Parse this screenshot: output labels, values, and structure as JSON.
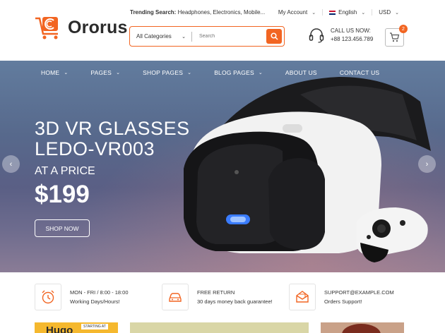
{
  "brand": {
    "name": "Ororus",
    "accent": "#f26522"
  },
  "header": {
    "trending_label": "Trending Search:",
    "trending_terms": "Headphones, Electronics, Mobile...",
    "account": "My Account",
    "language": "English",
    "currency": "USD",
    "search": {
      "category": "All Categories",
      "placeholder": "Search"
    },
    "call": {
      "label": "CALL US NOW:",
      "number": "+88 123.456.789"
    },
    "cart_count": "2"
  },
  "nav": {
    "items": [
      {
        "label": "HOME",
        "dropdown": true
      },
      {
        "label": "PAGES",
        "dropdown": true
      },
      {
        "label": "SHOP PAGES",
        "dropdown": true
      },
      {
        "label": "BLOG PAGES",
        "dropdown": true
      },
      {
        "label": "ABOUT US",
        "dropdown": false
      },
      {
        "label": "CONTACT US",
        "dropdown": false
      }
    ]
  },
  "hero": {
    "title_line1": "3D VR GLASSES",
    "title_line2": "LEDO-VR003",
    "price_label": "AT A PRICE",
    "price": "$199",
    "cta": "SHOP NOW"
  },
  "features": [
    {
      "icon": "alarm-clock-icon",
      "title": "MON - FRI / 8:00 - 18:00",
      "subtitle": "Working Days/Hours!"
    },
    {
      "icon": "car-icon",
      "title": "FREE RETURN",
      "subtitle": "30 days money back guarantee!"
    },
    {
      "icon": "envelope-icon",
      "title": "SUPPORT@EXAMPLE.COM",
      "subtitle": "Orders Support!"
    }
  ],
  "promo_partial": {
    "text1": "Hugo",
    "text2": "STARTING AT"
  }
}
